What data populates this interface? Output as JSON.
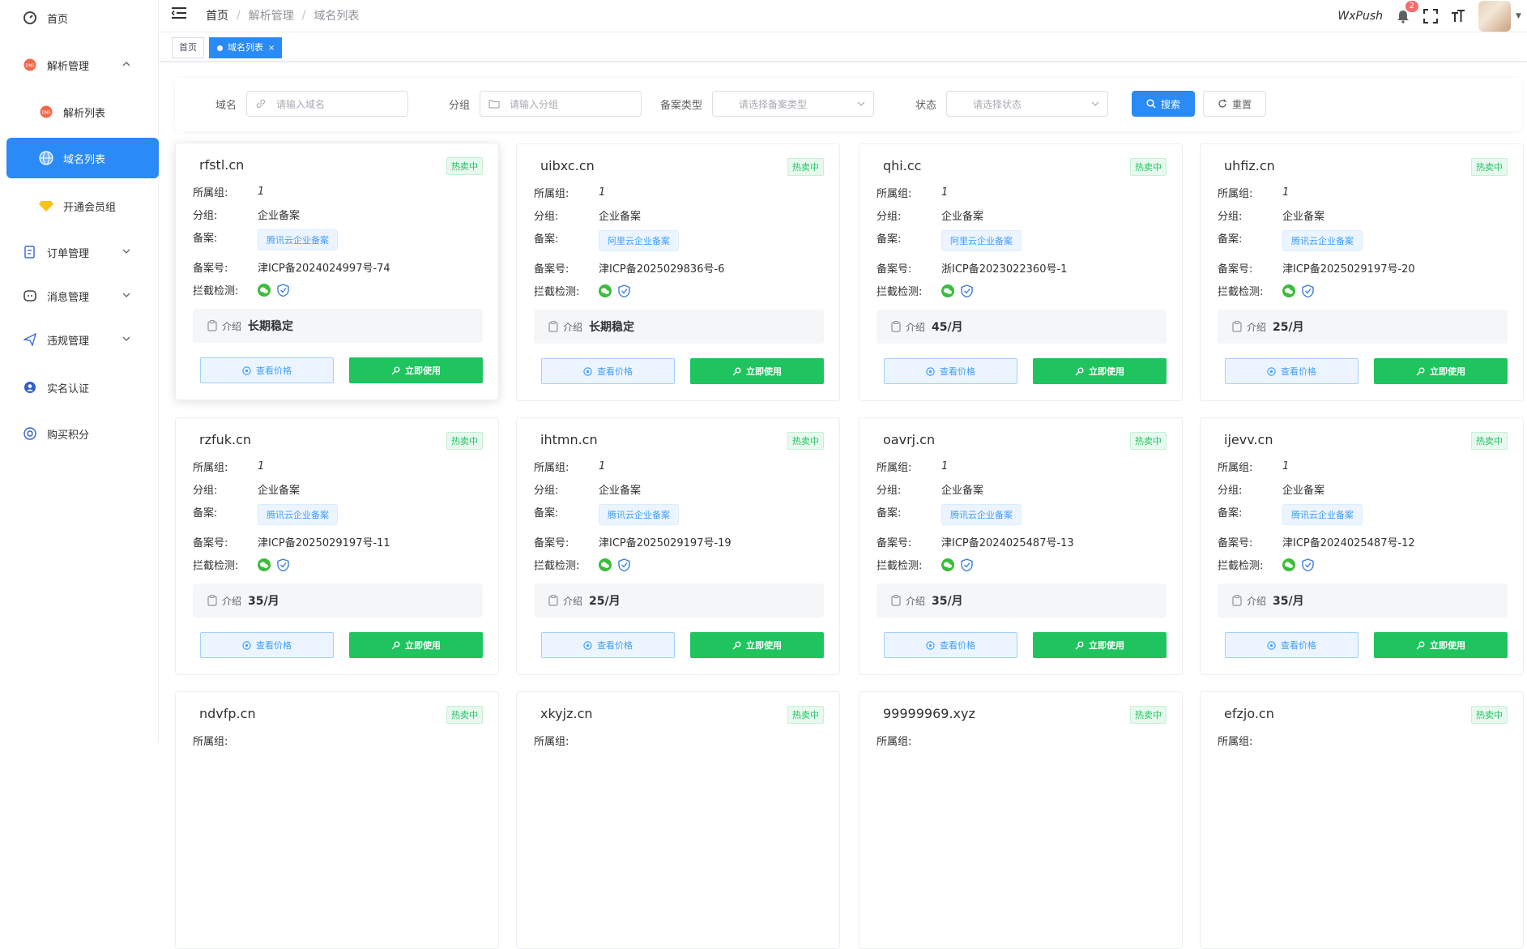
{
  "sidebar": {
    "items": [
      {
        "label": "首页",
        "icon": "dashboard-icon"
      },
      {
        "label": "解析管理",
        "icon": "dns-icon"
      },
      {
        "label": "解析列表",
        "icon": "dns-icon"
      },
      {
        "label": "域名列表",
        "icon": "globe-icon"
      },
      {
        "label": "开通会员组",
        "icon": "diamond-icon"
      },
      {
        "label": "订单管理",
        "icon": "order-icon"
      },
      {
        "label": "消息管理",
        "icon": "message-icon"
      },
      {
        "label": "违规管理",
        "icon": "send-icon"
      },
      {
        "label": "实名认证",
        "icon": "user-icon"
      },
      {
        "label": "购买积分",
        "icon": "coin-icon"
      }
    ]
  },
  "header": {
    "breadcrumb": [
      "首页",
      "解析管理",
      "域名列表"
    ],
    "wxpush": "WxPush",
    "notification_count": "2"
  },
  "tags": {
    "home": "首页",
    "current": "域名列表",
    "close": "×"
  },
  "search": {
    "domain_label": "域名",
    "domain_placeholder": "请输入域名",
    "group_label": "分组",
    "group_placeholder": "请输入分组",
    "filing_label": "备案类型",
    "filing_placeholder": "请选择备案类型",
    "status_label": "状态",
    "status_placeholder": "请选择状态",
    "search_btn": "搜索",
    "reset_btn": "重置"
  },
  "card_labels": {
    "owner_group": "所属组:",
    "group": "分组:",
    "filing": "备案:",
    "filing_no": "备案号:",
    "check": "拦截检测:",
    "intro": "介绍",
    "price_btn": "查看价格",
    "use_btn": "立即使用",
    "hot": "热卖中"
  },
  "cards": [
    {
      "domain": "rfstl.cn",
      "owner": "1",
      "group": "企业备案",
      "filing": "腾讯云企业备案",
      "filing_no": "津ICP备2024024997号-74",
      "intro": "长期稳定"
    },
    {
      "domain": "uibxc.cn",
      "owner": "1",
      "group": "企业备案",
      "filing": "阿里云企业备案",
      "filing_no": "津ICP备2025029836号-6",
      "intro": "长期稳定"
    },
    {
      "domain": "qhi.cc",
      "owner": "1",
      "group": "企业备案",
      "filing": "阿里云企业备案",
      "filing_no": "浙ICP备2023022360号-1",
      "intro": "45/月"
    },
    {
      "domain": "uhfiz.cn",
      "owner": "1",
      "group": "企业备案",
      "filing": "腾讯云企业备案",
      "filing_no": "津ICP备2025029197号-20",
      "intro": "25/月"
    },
    {
      "domain": "rzfuk.cn",
      "owner": "1",
      "group": "企业备案",
      "filing": "腾讯云企业备案",
      "filing_no": "津ICP备2025029197号-11",
      "intro": "35/月"
    },
    {
      "domain": "ihtmn.cn",
      "owner": "1",
      "group": "企业备案",
      "filing": "腾讯云企业备案",
      "filing_no": "津ICP备2025029197号-19",
      "intro": "25/月"
    },
    {
      "domain": "oavrj.cn",
      "owner": "1",
      "group": "企业备案",
      "filing": "腾讯云企业备案",
      "filing_no": "津ICP备2024025487号-13",
      "intro": "35/月"
    },
    {
      "domain": "ijevv.cn",
      "owner": "1",
      "group": "企业备案",
      "filing": "腾讯云企业备案",
      "filing_no": "津ICP备2024025487号-12",
      "intro": "35/月"
    },
    {
      "domain": "ndvfp.cn"
    },
    {
      "domain": "xkyjz.cn"
    },
    {
      "domain": "99999969.xyz"
    },
    {
      "domain": "efzjo.cn"
    }
  ]
}
